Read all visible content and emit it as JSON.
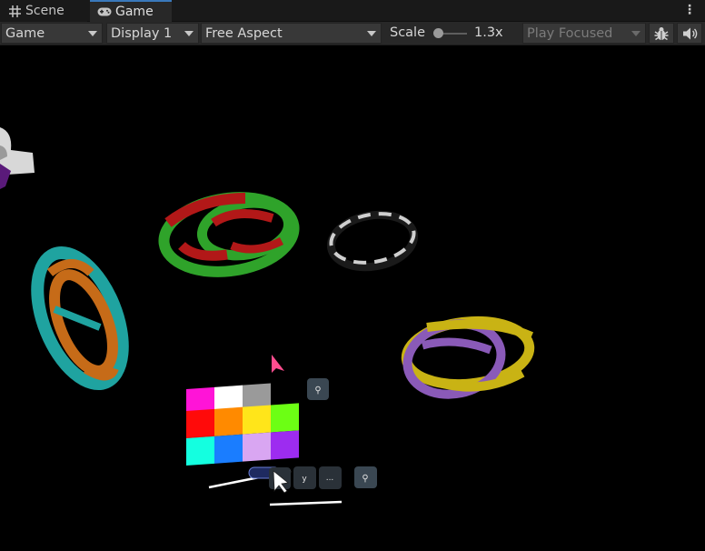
{
  "tabs": [
    {
      "label": "Scene",
      "icon": "grid-icon",
      "active": false
    },
    {
      "label": "Game",
      "icon": "gamepad-icon",
      "active": true
    }
  ],
  "toolbar": {
    "display_mode": "Game",
    "display": "Display 1",
    "aspect": "Free Aspect",
    "scale_label": "Scale",
    "scale_value": "1.3x",
    "play_mode": "Play Focused",
    "debug_icon": "bug-icon",
    "audio_icon": "speaker-icon"
  },
  "game_view": {
    "hand_menu": {
      "button_glyphs": [
        "y",
        "..."
      ],
      "pin_icon": "pin-icon",
      "palette_colors": [
        "#ff14d7",
        "#ffffff",
        "#9a9a9a",
        "#ff0a0a",
        "#ff8a00",
        "#ffe51a",
        "#6cff14",
        "#14ffe0",
        "#1a7dff",
        "#d9a6f2",
        "#9d2cf0"
      ]
    },
    "cursor_colors": {
      "pointer_pink": "#ff4d8f",
      "pointer_white": "#ffffff"
    },
    "rings": [
      "green-red",
      "gray-white",
      "teal-orange",
      "purple-yellow"
    ]
  },
  "colors": {
    "accent": "#3a79bb",
    "toolbar_bg": "#282828",
    "tab_bg": "#191919"
  }
}
